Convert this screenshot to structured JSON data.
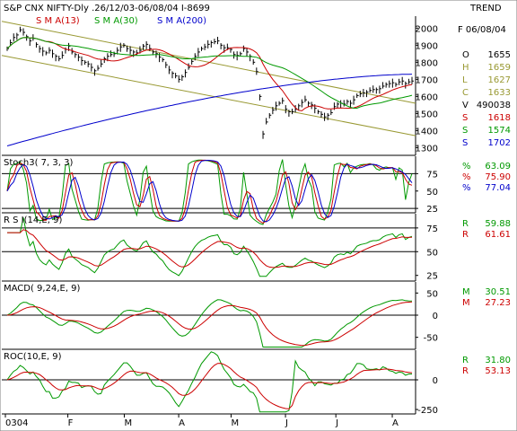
{
  "header": {
    "title": "S&P CNX NIFTY-Dly .26/12/03-06/08/04 I-8699",
    "trend": "TREND",
    "date": "F 06/08/04"
  },
  "colors": {
    "price": "#000000",
    "sma13": "#cc0000",
    "sma30": "#009900",
    "sma200": "#0000cc",
    "channel": "#999933",
    "grid": "#000000"
  },
  "x_axis": {
    "labels": [
      "0304",
      "F",
      "M",
      "A",
      "M",
      "J",
      "J",
      "A"
    ]
  },
  "chart_data": [
    {
      "type": "line",
      "name": "price",
      "ylim": [
        1260,
        2070
      ],
      "yticks": [
        1300,
        1400,
        1500,
        1600,
        1700,
        1800,
        1900,
        2000
      ],
      "legend": [
        {
          "label": "S M A(13)",
          "color": "#cc0000"
        },
        {
          "label": "S M A(30)",
          "color": "#009900"
        },
        {
          "label": "S M A(200)",
          "color": "#0000cc"
        }
      ],
      "close": [
        1880,
        1915,
        1945,
        1960,
        1990,
        1975,
        1950,
        1925,
        1940,
        1905,
        1880,
        1865,
        1855,
        1870,
        1850,
        1835,
        1820,
        1840,
        1875,
        1895,
        1860,
        1845,
        1830,
        1810,
        1800,
        1790,
        1770,
        1750,
        1765,
        1790,
        1820,
        1835,
        1845,
        1850,
        1870,
        1890,
        1900,
        1880,
        1870,
        1860,
        1855,
        1870,
        1895,
        1905,
        1880,
        1860,
        1850,
        1830,
        1815,
        1785,
        1755,
        1735,
        1720,
        1700,
        1715,
        1740,
        1770,
        1805,
        1835,
        1860,
        1880,
        1890,
        1905,
        1915,
        1920,
        1925,
        1900,
        1885,
        1885,
        1875,
        1845,
        1840,
        1850,
        1880,
        1860,
        1835,
        1800,
        1745,
        1600,
        1380,
        1450,
        1490,
        1520,
        1545,
        1560,
        1575,
        1525,
        1510,
        1510,
        1525,
        1545,
        1565,
        1580,
        1560,
        1550,
        1530,
        1510,
        1495,
        1480,
        1490,
        1505,
        1540,
        1555,
        1560,
        1555,
        1570,
        1560,
        1580,
        1605,
        1615,
        1620,
        1625,
        1635,
        1640,
        1640,
        1645,
        1660,
        1670,
        1675,
        1680,
        1670,
        1685,
        1690,
        1675,
        1685,
        1690
      ],
      "series_text": [
        {
          "label": "O",
          "value": "1655",
          "color": "#000000"
        },
        {
          "label": "H",
          "value": "1659",
          "color": "#999933"
        },
        {
          "label": "L",
          "value": "1627",
          "color": "#999933"
        },
        {
          "label": "C",
          "value": "1633",
          "color": "#999933"
        },
        {
          "label": "V",
          "value": "490038",
          "color": "#000000"
        },
        {
          "label": "S",
          "value": "1618",
          "color": "#cc0000"
        },
        {
          "label": "S",
          "value": "1574",
          "color": "#009900"
        },
        {
          "label": "S",
          "value": "1702",
          "color": "#0000cc"
        }
      ]
    },
    {
      "type": "line",
      "name": "stochastic",
      "title": "Stoch3( 7, 3, 3)",
      "ylim": [
        20,
        100
      ],
      "yticks": [
        25,
        50,
        75
      ],
      "series_text": [
        {
          "label": "%",
          "value": "63.09",
          "color": "#009900"
        },
        {
          "label": "%",
          "value": "75.90",
          "color": "#cc0000"
        },
        {
          "label": "%",
          "value": "77.04",
          "color": "#0000cc"
        }
      ]
    },
    {
      "type": "line",
      "name": "rsi",
      "title": "R S I(14,E, 9)",
      "ylim": [
        20,
        90
      ],
      "yticks": [
        25,
        50,
        75
      ],
      "series_text": [
        {
          "label": "R",
          "value": "59.88",
          "color": "#009900"
        },
        {
          "label": "R",
          "value": "61.61",
          "color": "#cc0000"
        }
      ]
    },
    {
      "type": "line",
      "name": "macd",
      "title": "MACD( 9,24,E, 9)",
      "ylim": [
        -75,
        75
      ],
      "yticks": [
        50,
        0,
        -50
      ],
      "series_text": [
        {
          "label": "M",
          "value": "30.51",
          "color": "#009900"
        },
        {
          "label": "M",
          "value": "27.23",
          "color": "#cc0000"
        }
      ]
    },
    {
      "type": "line",
      "name": "roc",
      "title": "ROC(10,E, 9)",
      "ylim": [
        -280,
        250
      ],
      "yticks": [
        0,
        -250
      ],
      "series_text": [
        {
          "label": "R",
          "value": "31.80",
          "color": "#009900"
        },
        {
          "label": "R",
          "value": "53.13",
          "color": "#cc0000"
        }
      ]
    }
  ]
}
